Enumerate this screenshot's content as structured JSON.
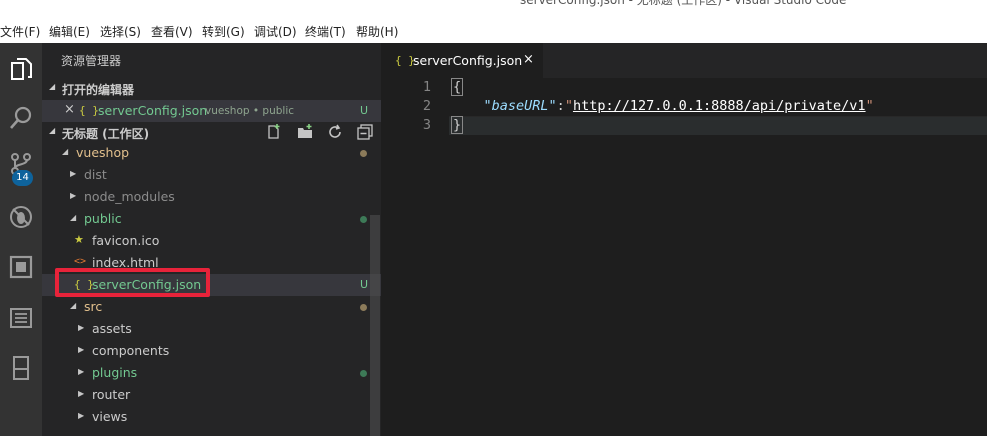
{
  "window": {
    "title": "serverConfig.json - 无标题 (工作区) - Visual Studio Code"
  },
  "menu": [
    "文件(F)",
    "编辑(E)",
    "选择(S)",
    "查看(V)",
    "转到(G)",
    "调试(D)",
    "终端(T)",
    "帮助(H)"
  ],
  "activity": {
    "scm_badge": "14"
  },
  "sidebar": {
    "title": "资源管理器",
    "open_editors_label": "打开的编辑器",
    "open_editor": {
      "close": "×",
      "icon": "{ }",
      "name": "serverConfig.json",
      "desc": "vueshop • public",
      "status": "U"
    },
    "workspace_label": "无标题 (工作区)",
    "tree": [
      {
        "label": "vueshop",
        "indent": 1,
        "twistie": "open",
        "color": "#e2c08d",
        "dot": "#8c7b5a"
      },
      {
        "label": "dist",
        "indent": 2,
        "twistie": "closed",
        "color": "#8c8c8c"
      },
      {
        "label": "node_modules",
        "indent": 2,
        "twistie": "closed",
        "color": "#8c8c8c"
      },
      {
        "label": "public",
        "indent": 2,
        "twistie": "open",
        "color": "#73c991",
        "dot": "#3d7a57"
      },
      {
        "label": "favicon.ico",
        "indent": 3,
        "icon": "★",
        "icon_color": "#cbcb41",
        "color": "#cccccc"
      },
      {
        "label": "index.html",
        "indent": 3,
        "icon": "<>",
        "icon_color": "#e37933",
        "color": "#cccccc"
      },
      {
        "label": "serverConfig.json",
        "indent": 3,
        "icon": "{ }",
        "icon_color": "#cbcb41",
        "color": "#73c991",
        "status": "U",
        "selected": true
      },
      {
        "label": "src",
        "indent": 2,
        "twistie": "open",
        "color": "#e2c08d",
        "dot": "#8c7b5a"
      },
      {
        "label": "assets",
        "indent": 3,
        "twistie": "closed",
        "color": "#cccccc"
      },
      {
        "label": "components",
        "indent": 3,
        "twistie": "closed",
        "color": "#cccccc"
      },
      {
        "label": "plugins",
        "indent": 3,
        "twistie": "closed",
        "color": "#73c991",
        "dot": "#3d7a57"
      },
      {
        "label": "router",
        "indent": 3,
        "twistie": "closed",
        "color": "#cccccc"
      },
      {
        "label": "views",
        "indent": 3,
        "twistie": "closed",
        "color": "#cccccc"
      }
    ]
  },
  "editor": {
    "tab": {
      "icon": "{ }",
      "name": "serverConfig.json",
      "close": "×"
    },
    "lines": [
      {
        "no": "1",
        "open": "{"
      },
      {
        "no": "2",
        "indent": "    ",
        "key": "\"baseURL\"",
        "sep": ":",
        "q1": "\"",
        "url": "http://127.0.0.1:8888/api/private/v1",
        "q2": "\""
      },
      {
        "no": "3",
        "close": "}"
      }
    ]
  },
  "colors": {
    "accent": "#0e639c",
    "highlight_box": "#e8233a",
    "untracked": "#73c991",
    "modified": "#e2c08d"
  }
}
